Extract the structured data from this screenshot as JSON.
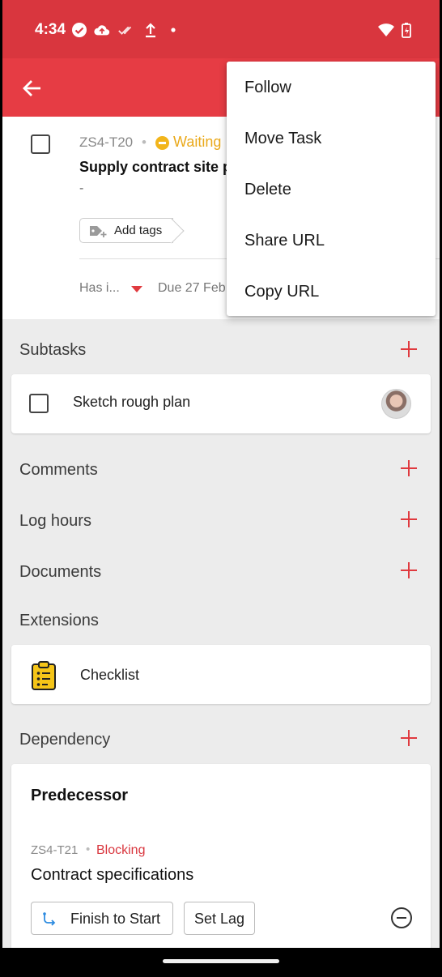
{
  "status_bar": {
    "time": "4:34",
    "icons": [
      "check-circle-icon",
      "cloud-upload-icon",
      "double-check-icon",
      "upload-icon",
      "dot-icon",
      "wifi-icon",
      "battery-charging-icon"
    ]
  },
  "app_bar": {
    "back_icon": "arrow-left-icon"
  },
  "task": {
    "id": "ZS4-T20",
    "separator": "•",
    "status": "Waiting",
    "title": "Supply contract site p",
    "description": "-",
    "add_tags_label": "Add tags",
    "relation": "Has i...",
    "due": "Due 27 Feb"
  },
  "menu": {
    "items": [
      "Follow",
      "Move Task",
      "Delete",
      "Share URL",
      "Copy URL"
    ]
  },
  "sections": {
    "subtasks": "Subtasks",
    "comments": "Comments",
    "log_hours": "Log hours",
    "documents": "Documents",
    "extensions": "Extensions",
    "dependency": "Dependency"
  },
  "subtasks": [
    {
      "label": "Sketch rough plan"
    }
  ],
  "extensions": [
    {
      "label": "Checklist",
      "icon": "clipboard-checklist-icon"
    }
  ],
  "dependency": {
    "heading": "Predecessor",
    "id": "ZS4-T21",
    "separator": "•",
    "status": "Blocking",
    "name": "Contract specifications",
    "type_label": "Finish to Start",
    "lag_label": "Set Lag"
  },
  "colors": {
    "status_bar": "#d9363e",
    "app_bar": "#e63c44",
    "accent": "#e03a3f",
    "waiting": "#eaa91b",
    "blocking": "#d9363e"
  }
}
